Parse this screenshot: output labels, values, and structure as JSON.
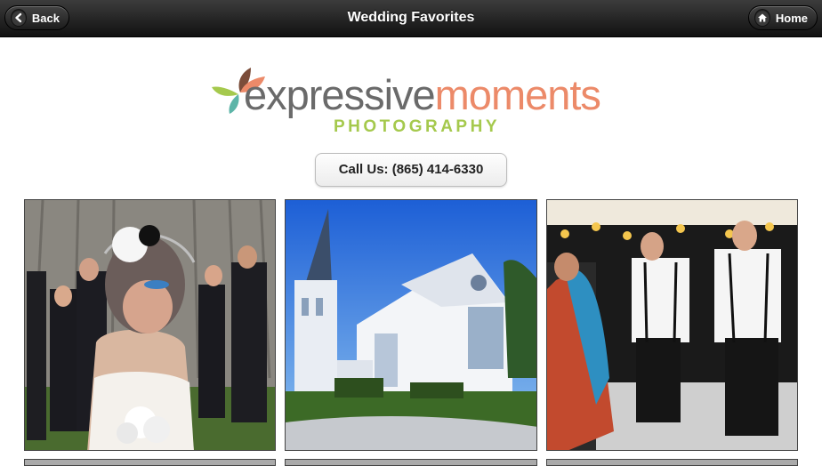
{
  "header": {
    "title": "Wedding Favorites",
    "back_label": "Back",
    "home_label": "Home"
  },
  "logo": {
    "word_part1": "expressive",
    "word_part2": "moments",
    "subtitle": "PHOTOGRAPHY"
  },
  "call_button": {
    "label": "Call Us: (865) 414-6330"
  },
  "colors": {
    "header": "#1c1c1c",
    "logo_gray": "#6a6a6a",
    "logo_orange": "#ec8a69",
    "logo_green": "#a5c94d"
  },
  "icons": {
    "back": "arrow-left-icon",
    "home": "home-icon"
  }
}
